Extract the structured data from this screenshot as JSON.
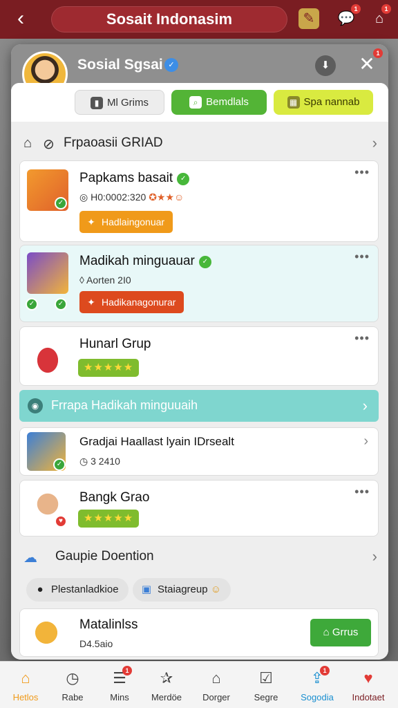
{
  "appbar": {
    "title": "Sosait Indonasim",
    "notification_count": "1",
    "alert_count": "1"
  },
  "modal": {
    "header": {
      "name": "Sosial Sgsai",
      "close_badge": "1"
    },
    "tabs": [
      {
        "label": "Ml Grims",
        "icon": "phone-icon"
      },
      {
        "label": "Bemdlals",
        "icon": "search-icon"
      },
      {
        "label": "Spa nannab",
        "icon": "grid-icon"
      }
    ],
    "section1": {
      "title": "Frpaoasii GRIAD"
    },
    "cards": [
      {
        "title": "Papkams basait",
        "subtitle": "H0:0002:320",
        "action": "Hadlaingonuar"
      },
      {
        "title": "Madikah minguauar",
        "subtitle": "Aorten 2I0",
        "action": "Hadikanagonurar"
      },
      {
        "title": "Hunarl Grup",
        "stars": "★★★★★"
      }
    ],
    "banner": {
      "text": "Frrapa Hadikah minguuaih"
    },
    "cards2": [
      {
        "title": "Gradjai Haallast lyain IDrsealt",
        "subtitle": "3 2410"
      },
      {
        "title": "Bangk Grao",
        "stars": "★★★★★"
      }
    ],
    "section2": {
      "title": "Gaupie Doention"
    },
    "chips": [
      {
        "label": "Plestanladkioe",
        "icon": "person-icon"
      },
      {
        "label": "Staiagreup",
        "icon": "folder-icon"
      }
    ],
    "bottom_card": {
      "title": "Matalinlss",
      "subtitle": "D4.5aio",
      "button": "Grrus"
    }
  },
  "nav": [
    {
      "label": "Hetlos",
      "icon": "home-icon",
      "active": true
    },
    {
      "label": "Rabe",
      "icon": "clock-icon"
    },
    {
      "label": "Mins",
      "icon": "list-icon",
      "badge": "1"
    },
    {
      "label": "Merdöe",
      "icon": "star-icon"
    },
    {
      "label": "Dorger",
      "icon": "house-icon"
    },
    {
      "label": "Segre",
      "icon": "chat-icon"
    },
    {
      "label": "Sogodia",
      "icon": "share-icon",
      "badge": "1"
    },
    {
      "label": "Indotaet",
      "icon": "heart-icon"
    }
  ],
  "colors": {
    "appbar": "#7a1d22",
    "green": "#53b436",
    "lime": "#d9ea40",
    "orange_pill": "#f09a1a",
    "red_pill": "#dd4a1e",
    "banner": "#7fd6cf",
    "nav_active": "#f09a1a"
  }
}
